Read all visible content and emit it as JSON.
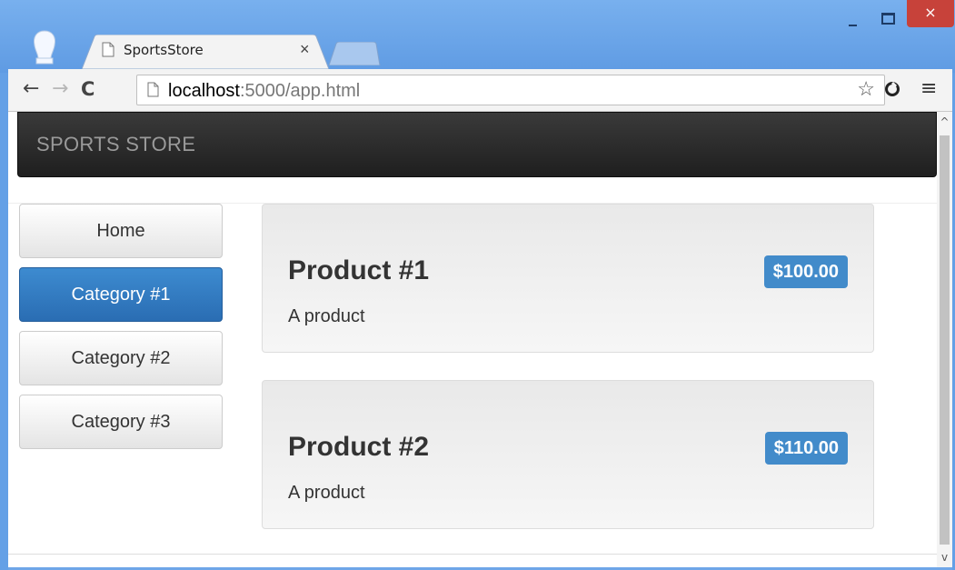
{
  "browser": {
    "tab": {
      "title": "SportsStore",
      "close_symbol": "×"
    },
    "window_controls": {
      "close_symbol": "×"
    },
    "nav": {
      "back_symbol": "←",
      "forward_symbol": "→",
      "reload_symbol": "C"
    },
    "address": {
      "host": "localhost",
      "path": ":5000/app.html"
    },
    "bookmark_symbol": "☆",
    "menu_symbol": "≡"
  },
  "page": {
    "brand": "SPORTS STORE",
    "categories": [
      {
        "label": "Home",
        "active": false
      },
      {
        "label": "Category #1",
        "active": true
      },
      {
        "label": "Category #2",
        "active": false
      },
      {
        "label": "Category #3",
        "active": false
      }
    ],
    "products": [
      {
        "name": "Product #1",
        "price": "$100.00",
        "description": "A product"
      },
      {
        "name": "Product #2",
        "price": "$110.00",
        "description": "A product"
      }
    ]
  },
  "scrollbar": {
    "up_symbol": "^",
    "down_symbol": "v"
  },
  "colors": {
    "frame": "#6fa6e8",
    "navbar": "#222222",
    "active_button": "#2f7ac1",
    "price_badge": "#428bca",
    "close_button": "#c7423a"
  }
}
